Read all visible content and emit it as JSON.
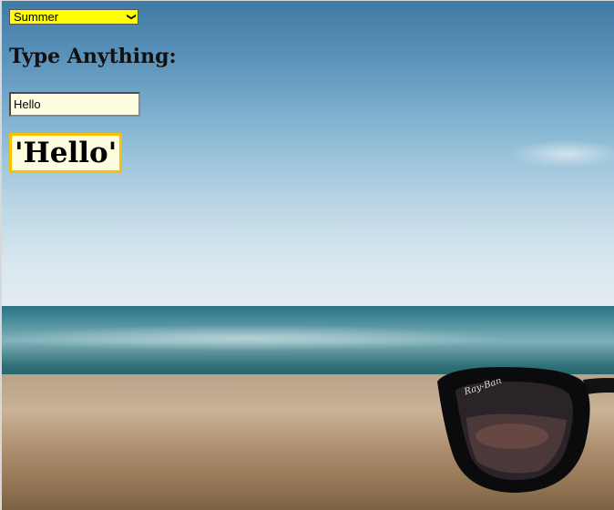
{
  "season_select": {
    "selected": "Summer"
  },
  "prompt": {
    "heading": "Type Anything:"
  },
  "text_input": {
    "value": "Hello"
  },
  "echo": {
    "text": "'Hello'"
  },
  "background": {
    "scene": "beach with sunglasses",
    "sunglasses_brand": "Ray-Ban"
  },
  "colors": {
    "select_bg": "#ffff00",
    "input_bg": "#fffde0",
    "echo_border": "#f5c400"
  }
}
